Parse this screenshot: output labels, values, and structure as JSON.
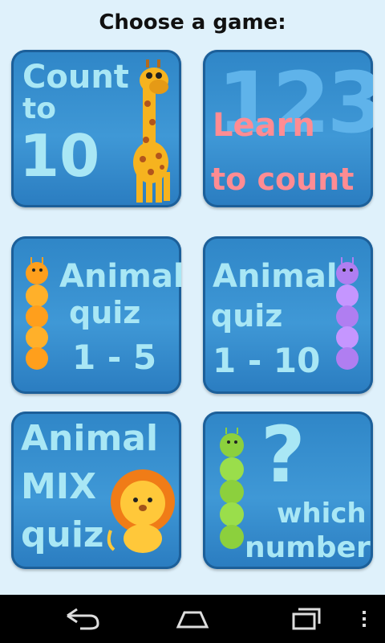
{
  "header": {
    "title": "Choose a game:"
  },
  "games": [
    {
      "line1": "Count",
      "line2": "to",
      "line3": "10"
    },
    {
      "bg_numbers": "123",
      "line1": "Learn",
      "line2": "to count"
    },
    {
      "line1": "Animal",
      "line2": "quiz",
      "line3": "1 - 5"
    },
    {
      "line1": "Animal",
      "line2": "quiz",
      "line3": "1 - 10"
    },
    {
      "line1": "Animal",
      "line2": "MIX",
      "line3": "quiz"
    },
    {
      "symbol": "?",
      "line1": "which",
      "line2": "number"
    }
  ],
  "navbar": {
    "icons": [
      "back-icon",
      "home-icon",
      "recent-apps-icon",
      "menu-icon"
    ]
  },
  "colors": {
    "card": "#3a92d2",
    "label": "#a9e7f5",
    "pink": "#ff8c93",
    "background": "#dff1fb"
  }
}
